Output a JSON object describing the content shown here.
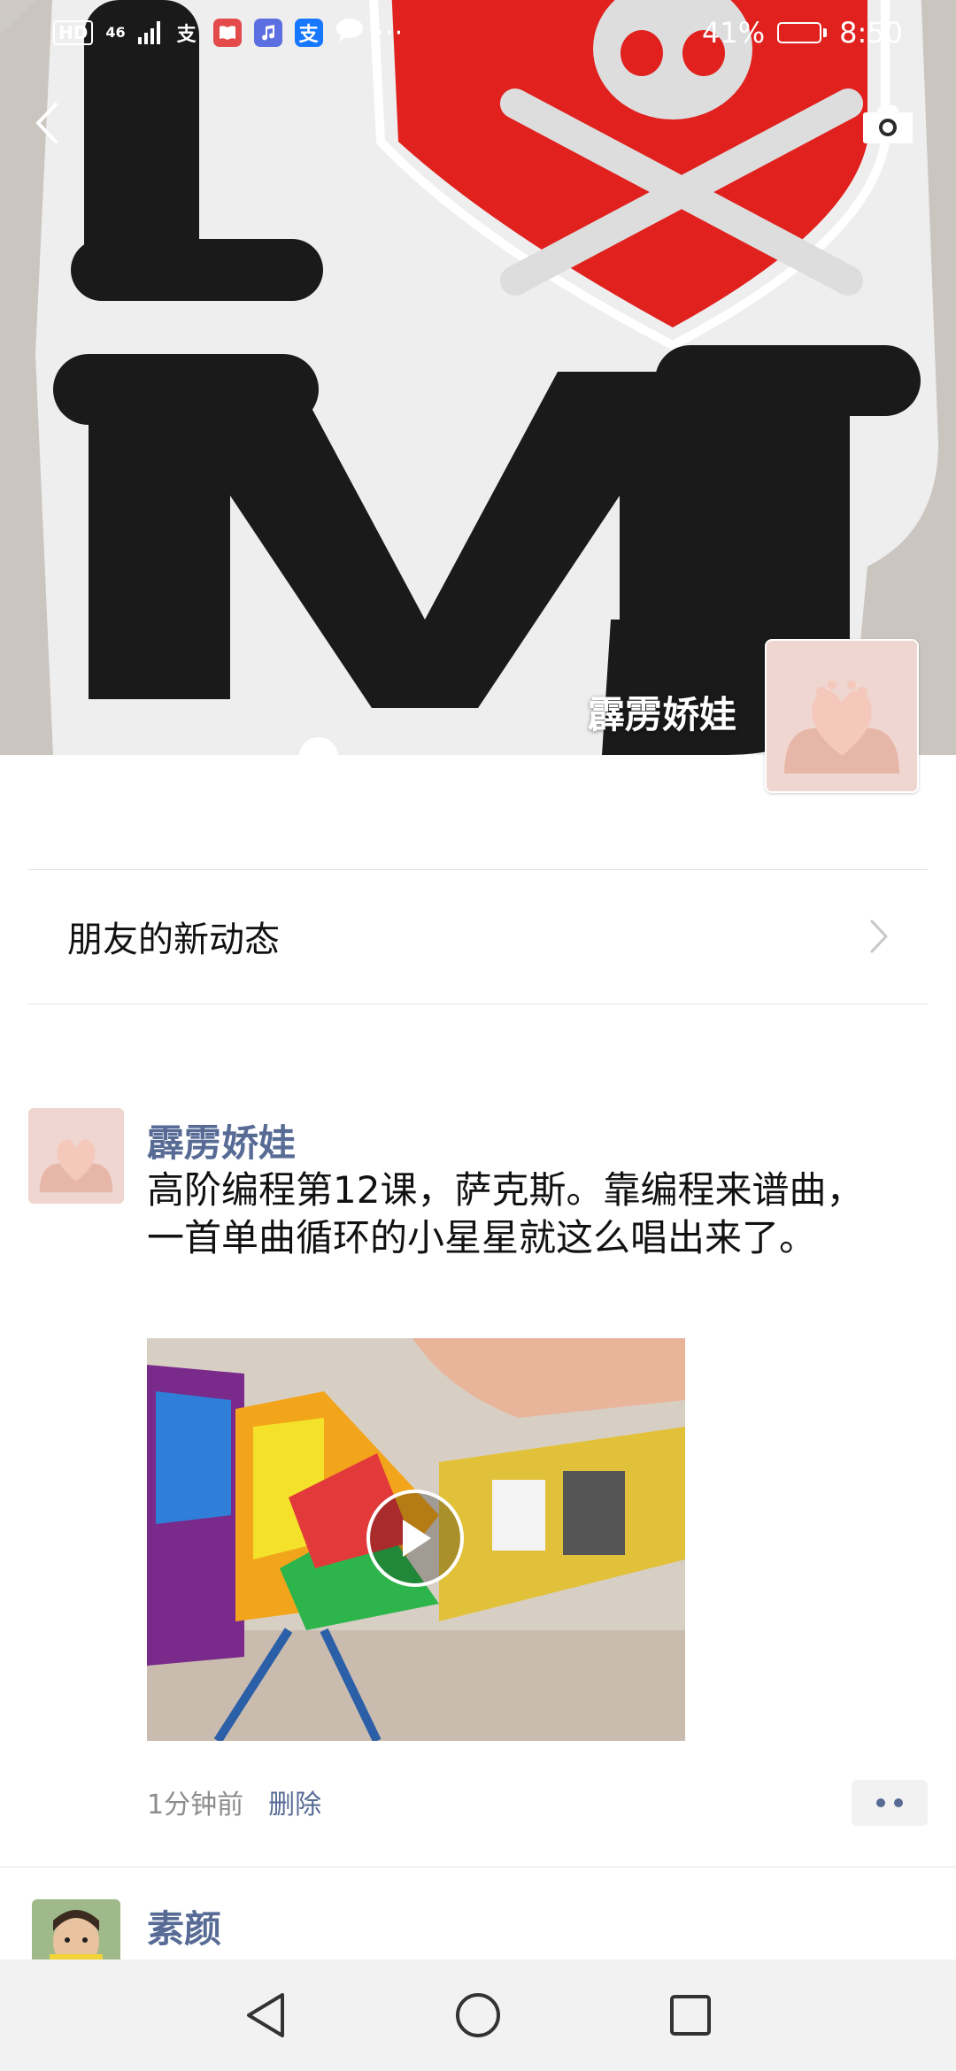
{
  "status_bar": {
    "hd_tag": "HD",
    "network": "46",
    "app_alipay_glyph": "支",
    "app_alipay2_glyph": "支",
    "more_dots": "···",
    "battery_percent": "41%",
    "time": "8:50",
    "battery_level": 0.41
  },
  "cover": {
    "username": "霹雳娇娃",
    "back_icon": "chevron-left-icon",
    "camera_icon": "camera-icon",
    "sign_text": "I MJ"
  },
  "friends_updates": {
    "label": "朋友的新动态"
  },
  "posts": [
    {
      "author": "霹雳娇娃",
      "text": "高阶编程第12课，萨克斯。靠编程来谱曲，一首单曲循环的小星星就这么唱出来了。",
      "time_ago": "1分钟前",
      "delete_label": "删除"
    },
    {
      "author": "素颜"
    }
  ],
  "colors": {
    "link_blue": "#576b95",
    "heart_red": "#e0211e",
    "nav_bg": "#f2f2f2"
  }
}
